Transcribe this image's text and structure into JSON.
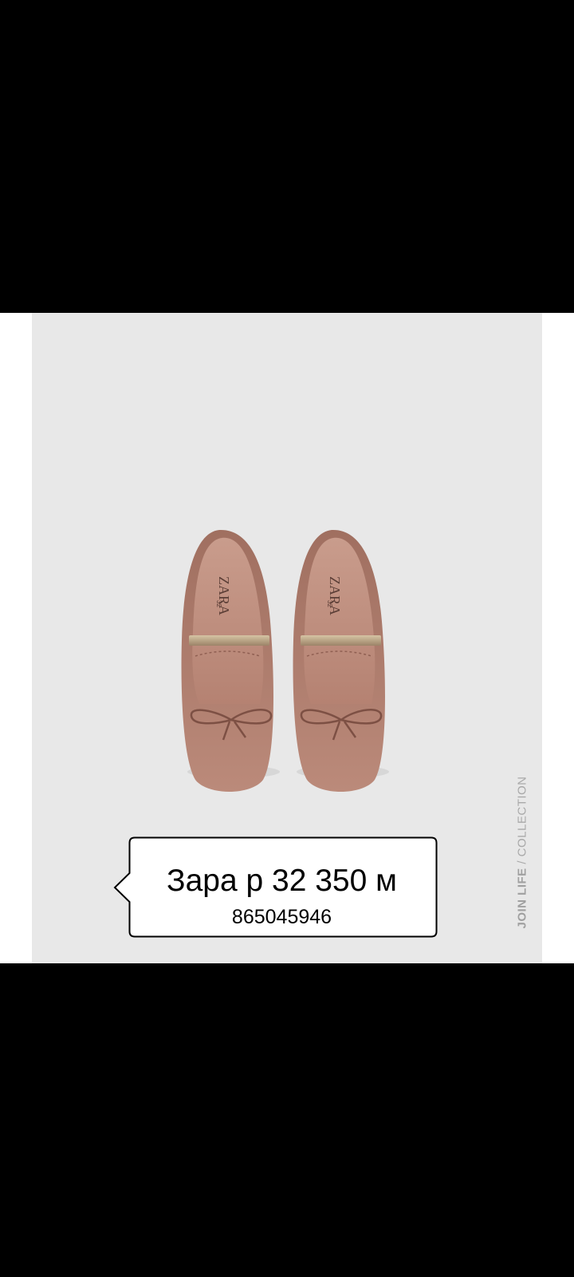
{
  "photo": {
    "description_label": "product-photo",
    "logo_text_left": "ZARA",
    "logo_text_right": "ZARA",
    "size_left": "32",
    "size_right": "32",
    "watermark_strong": "JOIN LIFE",
    "watermark_light": " / COLLECTION"
  },
  "overlay": {
    "title": "Зара р 32 350 м",
    "phone": "865045946"
  },
  "colors": {
    "background": "#000000",
    "photo_bg": "#e8e8e8",
    "shoe": "#b07e6e",
    "bubble_bg": "#ffffff",
    "bubble_border": "#000000"
  }
}
